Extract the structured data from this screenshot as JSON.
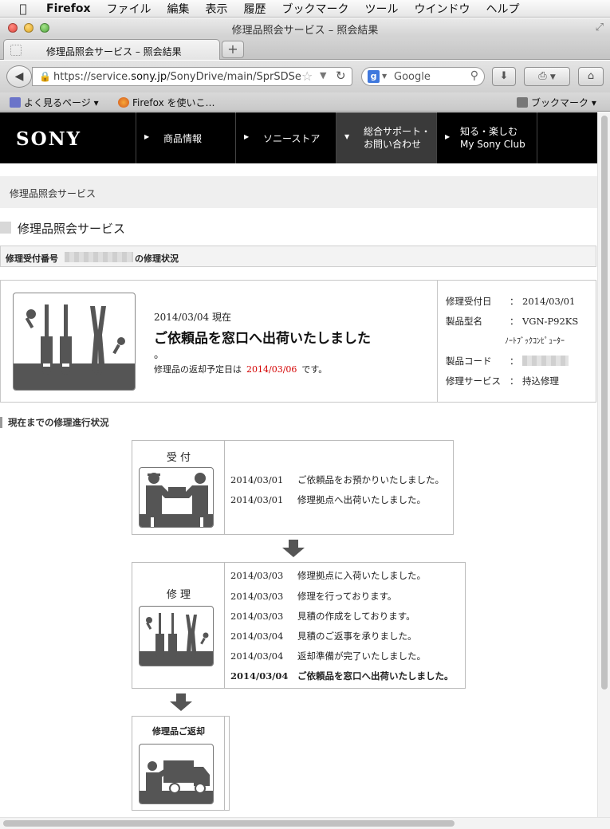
{
  "menubar": {
    "app_name": "Firefox",
    "items": [
      "ファイル",
      "編集",
      "表示",
      "履歴",
      "ブックマーク",
      "ツール",
      "ウインドウ",
      "ヘルプ"
    ]
  },
  "window": {
    "title": "修理品照会サービス – 照会結果"
  },
  "tab": {
    "label": "修理品照会サービス – 照会結果",
    "new_tab": "+"
  },
  "navbar": {
    "url_prefix": "https://service.",
    "url_domain": "sony.jp",
    "url_path": "/SonyDrive/main/SprSDSe",
    "search_engine": "Google",
    "search_placeholder": "Google"
  },
  "bookmarks": {
    "left1": "よく見るページ ▾",
    "left2": "Firefox を使いこ…",
    "right": "ブックマーク ▾"
  },
  "site": {
    "logo": "SONY",
    "nav": [
      {
        "label": "商品情報"
      },
      {
        "label": "ソニーストア"
      },
      {
        "line1": "総合サポート・",
        "line2": "お問い合わせ"
      },
      {
        "line1": "知る・楽しむ",
        "line2": "My Sony Club"
      }
    ],
    "breadcrumb": "修理品照会サービス",
    "page_title": "修理品照会サービス",
    "id_label": "修理受付番号",
    "id_suffix": "の修理状況"
  },
  "status": {
    "as_of": "2014/03/04 現在",
    "headline": "ご依頼品を窓口へ出荷いたしました",
    "headline_tail": "。",
    "return_prefix": "修理品の返却予定日は",
    "return_date": "2014/03/06",
    "return_suffix": "です。",
    "accent_color": "#d40000",
    "info": {
      "received_label": "修理受付日",
      "received_value": "2014/03/01",
      "model_label": "製品型名",
      "model_value": "VGN-P92KS",
      "model_type": "ﾉｰﾄﾌﾞｯｸｺﾝﾋﾟｭｰﾀｰ",
      "code_label": "製品コード",
      "service_label": "修理サービス",
      "service_value": "持込修理",
      "colon": "："
    }
  },
  "progress": {
    "title": "現在までの修理進行状況",
    "steps": [
      {
        "label": "受 付",
        "icon": "handover-icon",
        "logs": [
          {
            "date": "2014/03/01",
            "text": "ご依頼品をお預かりいたしました。"
          },
          {
            "date": "2014/03/01",
            "text": "修理拠点へ出荷いたしました。"
          }
        ]
      },
      {
        "label": "修 理",
        "icon": "tools-icon",
        "logs": [
          {
            "date": "2014/03/03",
            "text": "修理拠点に入荷いたしました。"
          },
          {
            "date": "2014/03/03",
            "text": "修理を行っております。"
          },
          {
            "date": "2014/03/03",
            "text": "見積の作成をしております。"
          },
          {
            "date": "2014/03/04",
            "text": "見積のご返事を承りました。"
          },
          {
            "date": "2014/03/04",
            "text": "返却準備が完了いたしました。"
          },
          {
            "date": "2014/03/04",
            "text": "ご依頼品を窓口へ出荷いたしました。"
          }
        ]
      },
      {
        "label": "修理品ご返却",
        "icon": "delivery-truck-icon",
        "logs": []
      }
    ]
  }
}
